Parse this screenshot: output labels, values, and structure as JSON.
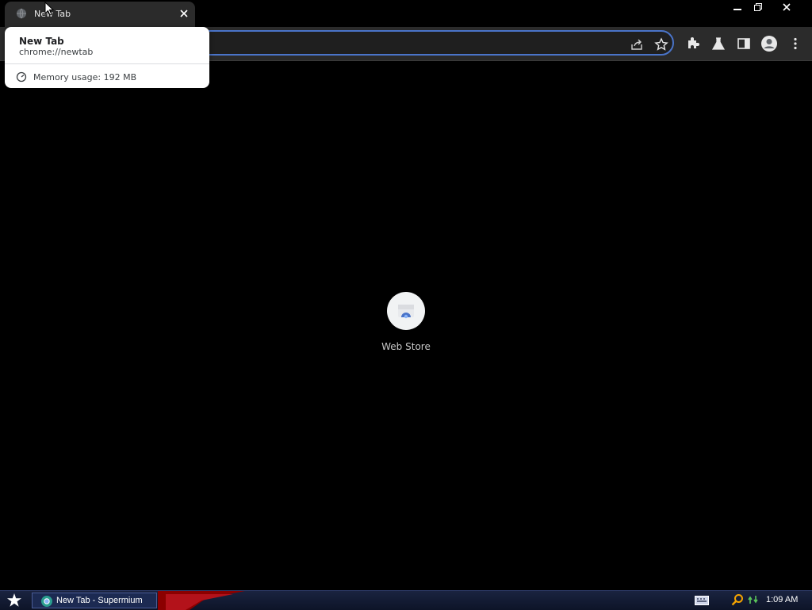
{
  "browser": {
    "tab": {
      "title": "New Tab"
    },
    "window_controls": [
      "minimize",
      "restore",
      "close"
    ]
  },
  "hover_card": {
    "title": "New Tab",
    "url": "chrome://newtab",
    "memory": "Memory usage: 192 MB"
  },
  "toolbar": {
    "icons": [
      "share-icon",
      "bookmark-star-icon",
      "extensions-icon",
      "labs-flask-icon",
      "side-panel-icon",
      "profile-icon",
      "menu-icon"
    ]
  },
  "newtab": {
    "shortcuts": [
      {
        "label": "Web Store"
      }
    ]
  },
  "taskbar": {
    "task_label": "New Tab - Supermium",
    "clock": "1:09 AM"
  },
  "colors": {
    "omnibox_focus_ring": "#4a74c9",
    "toolbar_bg": "#2b2b2b",
    "page_bg": "#000000"
  }
}
